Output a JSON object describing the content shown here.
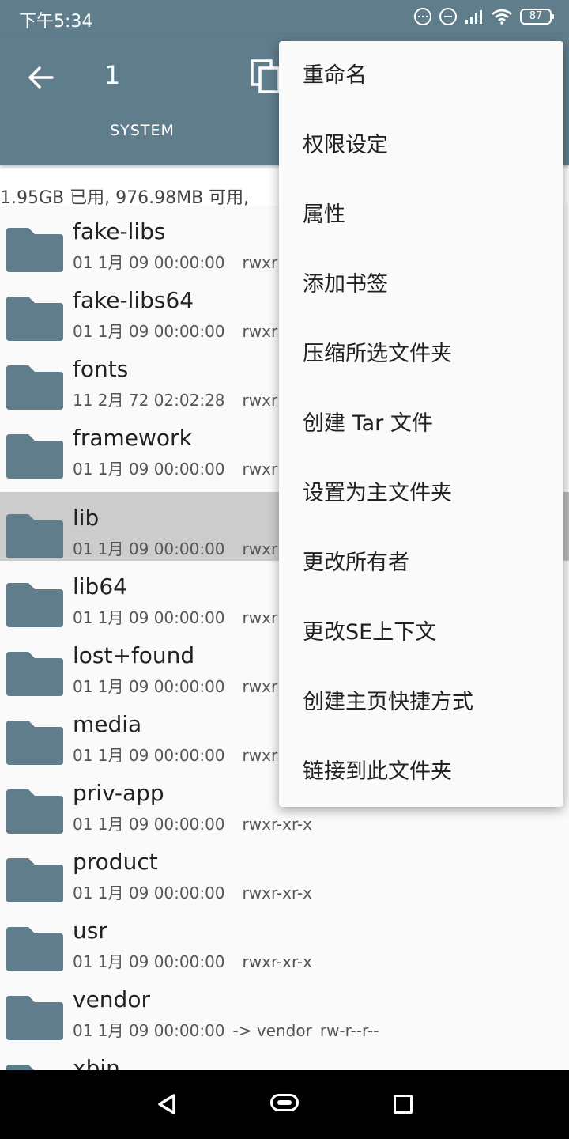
{
  "status_bar": {
    "time": "下午5:34",
    "battery": "87"
  },
  "app_bar": {
    "title": "1",
    "tab": "SYSTEM"
  },
  "storage_info": "1.95GB 已用, 976.98MB 可用,",
  "files": [
    {
      "name": "fake-libs",
      "date": "01 1月 09 00:00:00",
      "perm": "rwxr"
    },
    {
      "name": "fake-libs64",
      "date": "01 1月 09 00:00:00",
      "perm": "rwxr"
    },
    {
      "name": "fonts",
      "date": "11 2月 72 02:02:28",
      "perm": "rwxr"
    },
    {
      "name": "framework",
      "date": "01 1月 09 00:00:00",
      "perm": "rwxr"
    },
    {
      "name": "lib",
      "date": "01 1月 09 00:00:00",
      "perm": "rwxr"
    },
    {
      "name": "lib64",
      "date": "01 1月 09 00:00:00",
      "perm": "rwxr"
    },
    {
      "name": "lost+found",
      "date": "01 1月 09 00:00:00",
      "perm": "rwxr"
    },
    {
      "name": "media",
      "date": "01 1月 09 00:00:00",
      "perm": "rwxr"
    },
    {
      "name": "priv-app",
      "date": "01 1月 09 00:00:00",
      "perm": "rwxr-xr-x"
    },
    {
      "name": "product",
      "date": "01 1月 09 00:00:00",
      "perm": "rwxr-xr-x"
    },
    {
      "name": "usr",
      "date": "01 1月 09 00:00:00",
      "perm": "rwxr-xr-x"
    },
    {
      "name": "vendor",
      "date": "01 1月 09 00:00:00",
      "link": "-> vendor",
      "perm": "rw-r--r--"
    },
    {
      "name": "xbin",
      "date": "",
      "perm": ""
    }
  ],
  "context_menu": [
    "重命名",
    "权限设定",
    "属性",
    "添加书签",
    "压缩所选文件夹",
    "创建 Tar 文件",
    "设置为主文件夹",
    "更改所有者",
    "更改SE上下文",
    "创建主页快捷方式",
    "链接到此文件夹"
  ],
  "colors": {
    "primary": "#607D8B",
    "folder": "#607D8B",
    "selected_row": "#cccccc"
  }
}
